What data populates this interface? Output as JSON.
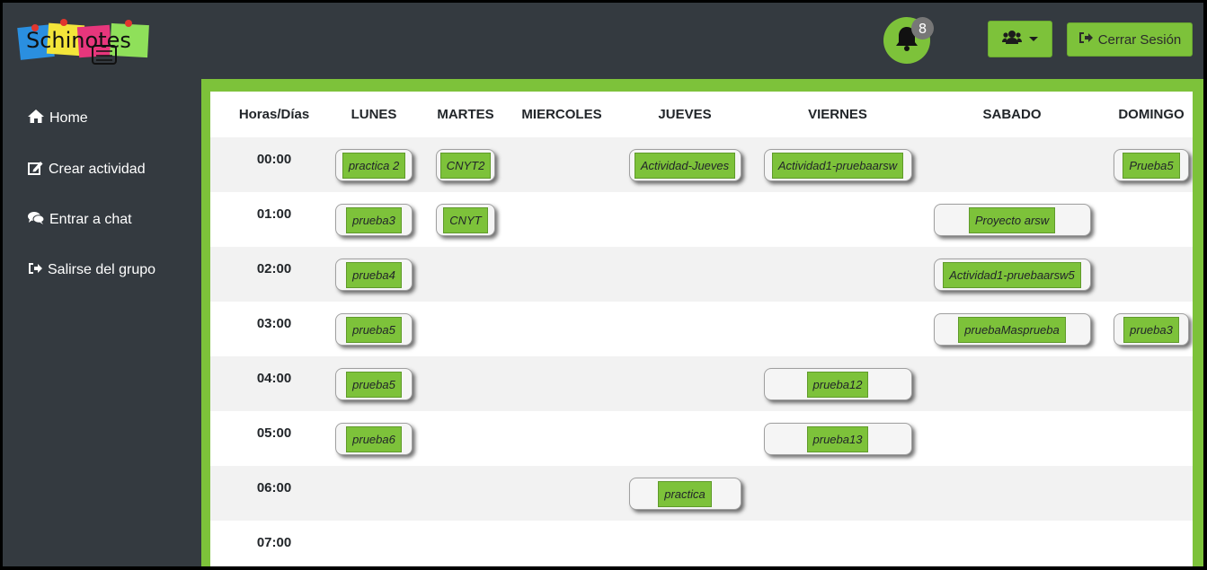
{
  "header": {
    "logo_text": "Schinotes",
    "notifications_count": "8",
    "logout_label": "Cerrar Sesión"
  },
  "colors": {
    "accent": "#7dc23a",
    "dark": "#343a40"
  },
  "sidebar": {
    "items": [
      {
        "label": "Home",
        "icon": "home-icon"
      },
      {
        "label": "Crear actividad",
        "icon": "edit-icon"
      },
      {
        "label": "Entrar a chat",
        "icon": "comments-icon"
      },
      {
        "label": "Salirse del grupo",
        "icon": "sign-out-icon"
      }
    ]
  },
  "schedule": {
    "headers": [
      "Horas/Días",
      "LUNES",
      "MARTES",
      "MIERCOLES",
      "JUEVES",
      "VIERNES",
      "SABADO",
      "DOMINGO"
    ],
    "hours": [
      "00:00",
      "01:00",
      "02:00",
      "03:00",
      "04:00",
      "05:00",
      "06:00",
      "07:00"
    ],
    "activities": [
      {
        "hour": 0,
        "day": 1,
        "label": "practica 2"
      },
      {
        "hour": 0,
        "day": 2,
        "label": "CNYT2"
      },
      {
        "hour": 0,
        "day": 4,
        "label": "Actividad-Jueves"
      },
      {
        "hour": 0,
        "day": 5,
        "label": "Actividad1-pruebaarsw"
      },
      {
        "hour": 0,
        "day": 7,
        "label": "Prueba5"
      },
      {
        "hour": 1,
        "day": 1,
        "label": "prueba3"
      },
      {
        "hour": 1,
        "day": 2,
        "label": "CNYT"
      },
      {
        "hour": 1,
        "day": 6,
        "label": "Proyecto arsw"
      },
      {
        "hour": 2,
        "day": 1,
        "label": "prueba4"
      },
      {
        "hour": 2,
        "day": 6,
        "label": "Actividad1-pruebaarsw5"
      },
      {
        "hour": 3,
        "day": 1,
        "label": "prueba5"
      },
      {
        "hour": 3,
        "day": 6,
        "label": "pruebaMasprueba"
      },
      {
        "hour": 3,
        "day": 7,
        "label": "prueba3"
      },
      {
        "hour": 4,
        "day": 1,
        "label": "prueba5"
      },
      {
        "hour": 4,
        "day": 5,
        "label": "prueba12"
      },
      {
        "hour": 5,
        "day": 1,
        "label": "prueba6"
      },
      {
        "hour": 5,
        "day": 5,
        "label": "prueba13"
      },
      {
        "hour": 6,
        "day": 4,
        "label": "practica"
      }
    ]
  }
}
